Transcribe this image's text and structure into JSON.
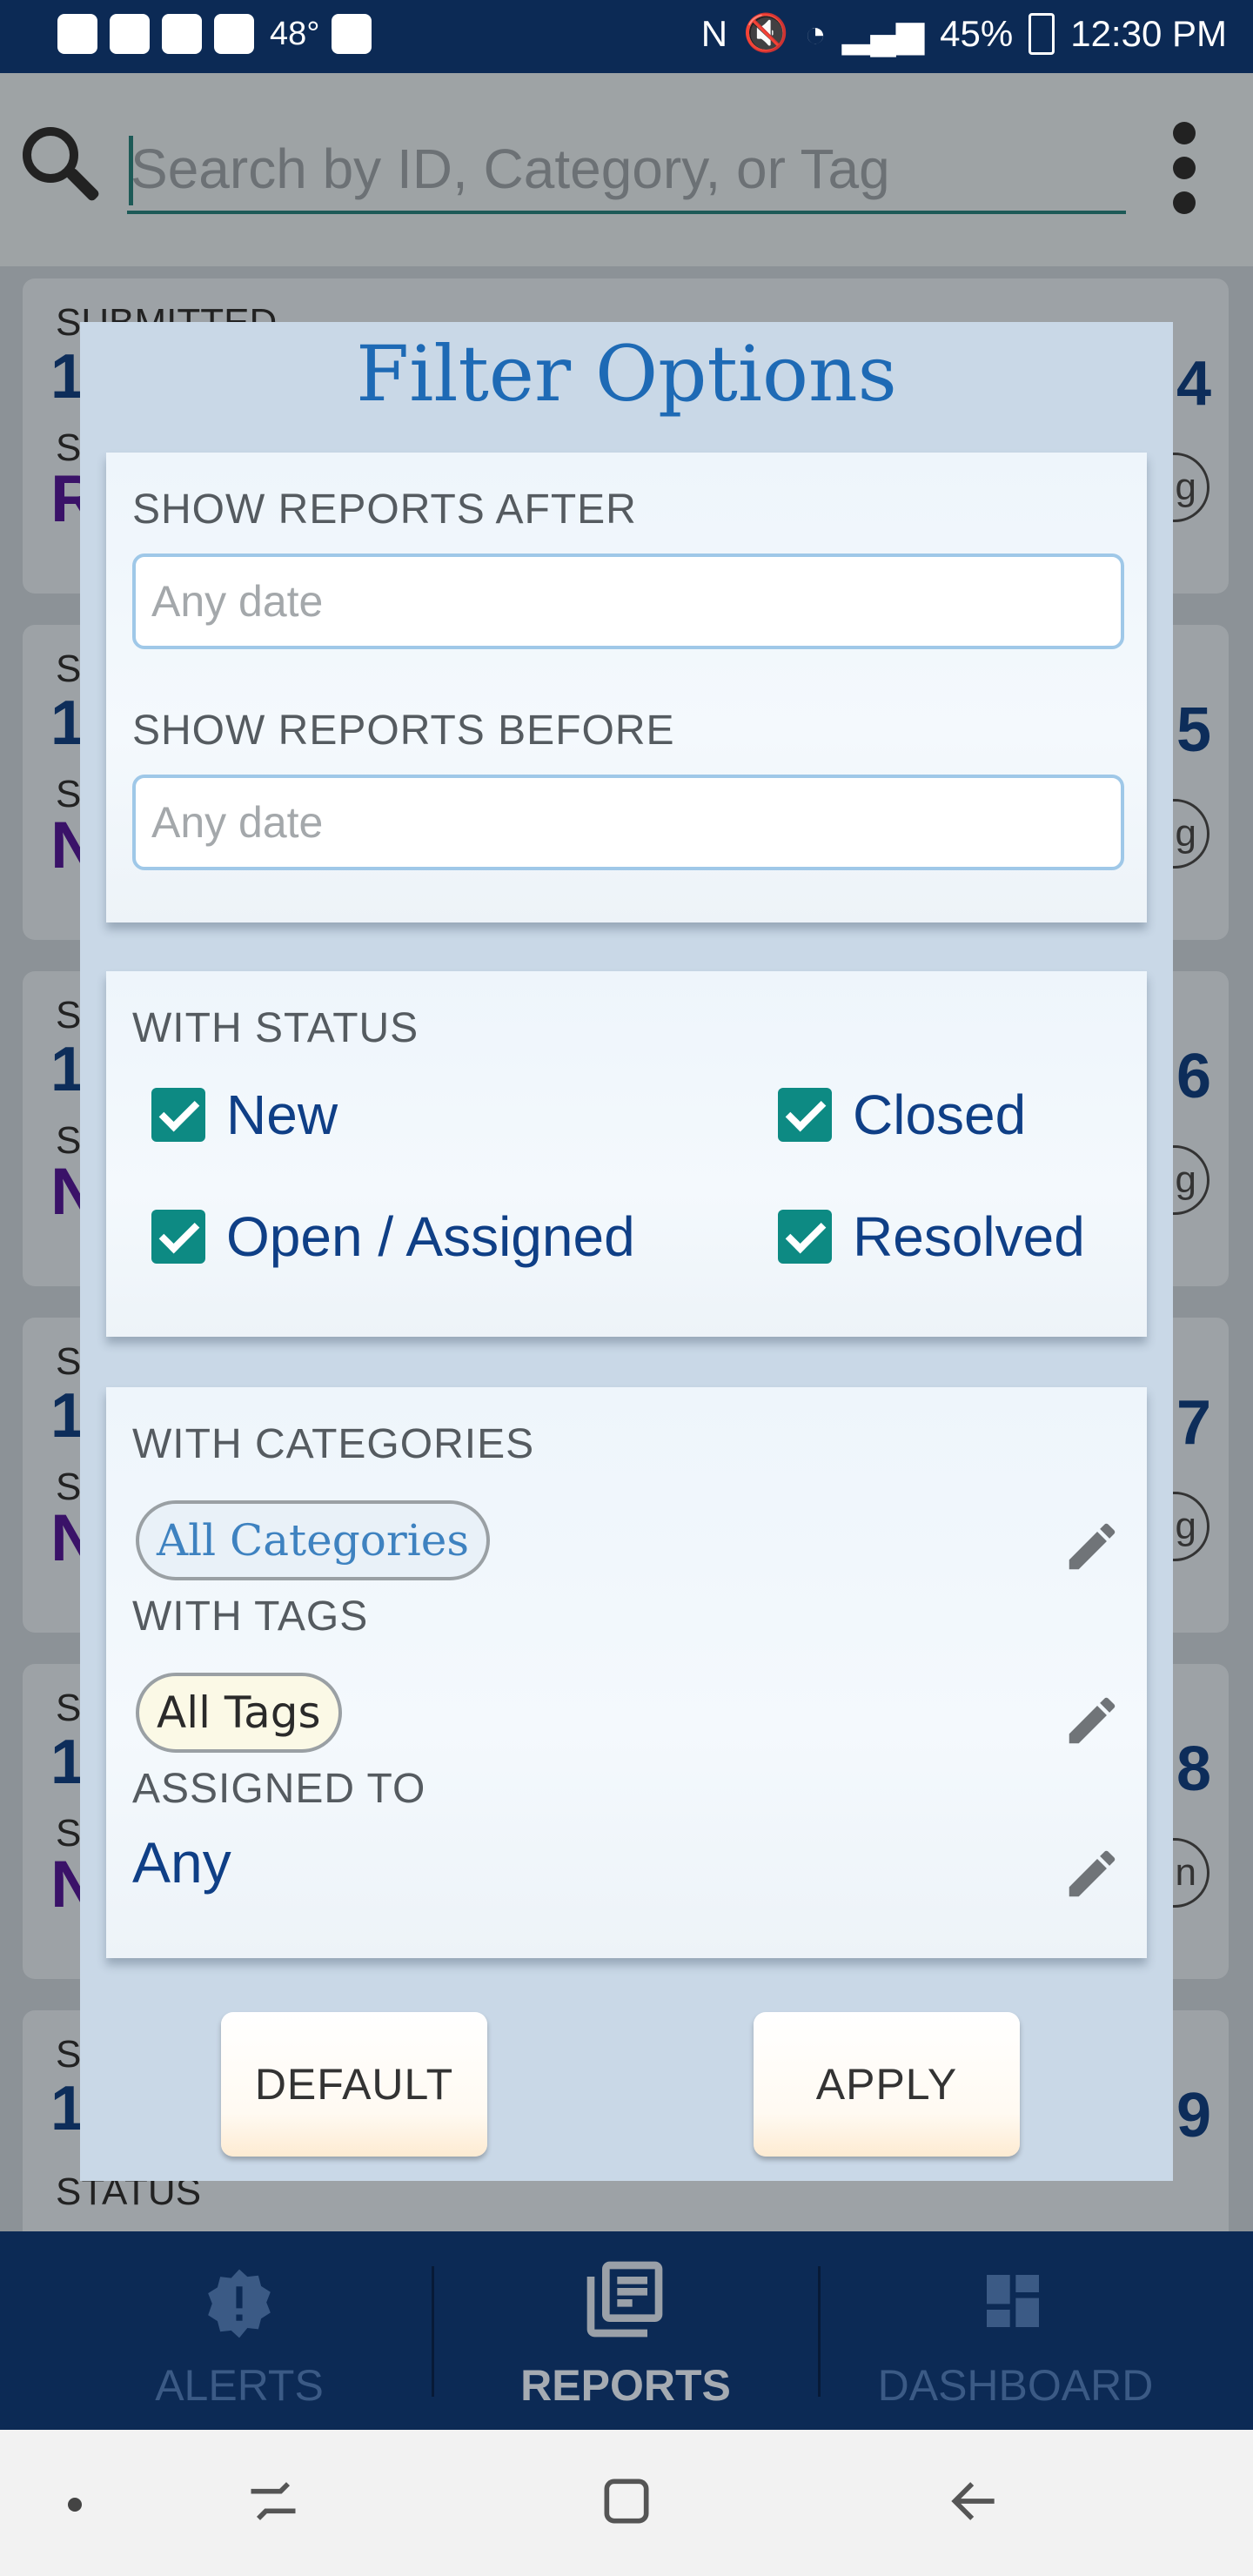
{
  "status_bar": {
    "temperature": "48°",
    "battery": "45%",
    "time": "12:30 PM"
  },
  "search": {
    "placeholder": "Search by ID, Category, or Tag"
  },
  "background_list": {
    "first_label": "SUBMITTED",
    "bottom_label": "STATUS"
  },
  "modal": {
    "title": "Filter Options",
    "date_section": {
      "after_label": "SHOW REPORTS AFTER",
      "after_placeholder": "Any date",
      "before_label": "SHOW REPORTS BEFORE",
      "before_placeholder": "Any date"
    },
    "status_section": {
      "label": "WITH STATUS",
      "options": [
        {
          "label": "New",
          "checked": true
        },
        {
          "label": "Closed",
          "checked": true
        },
        {
          "label": "Open / Assigned",
          "checked": true
        },
        {
          "label": "Resolved",
          "checked": true
        }
      ]
    },
    "filters_section": {
      "categories_label": "WITH CATEGORIES",
      "categories_value": "All Categories",
      "tags_label": "WITH TAGS",
      "tags_value": "All Tags",
      "assigned_label": "ASSIGNED TO",
      "assigned_value": "Any"
    },
    "buttons": {
      "default": "DEFAULT",
      "apply": "APPLY"
    }
  },
  "bottom_nav": {
    "items": [
      {
        "label": "ALERTS",
        "icon": "alert-badge-icon",
        "active": false
      },
      {
        "label": "REPORTS",
        "icon": "reports-icon",
        "active": true
      },
      {
        "label": "DASHBOARD",
        "icon": "dashboard-icon",
        "active": false
      }
    ]
  },
  "colors": {
    "primary_dark": "#0c2a55",
    "accent_teal": "#0d8a83",
    "title_blue": "#1e6ab5"
  }
}
